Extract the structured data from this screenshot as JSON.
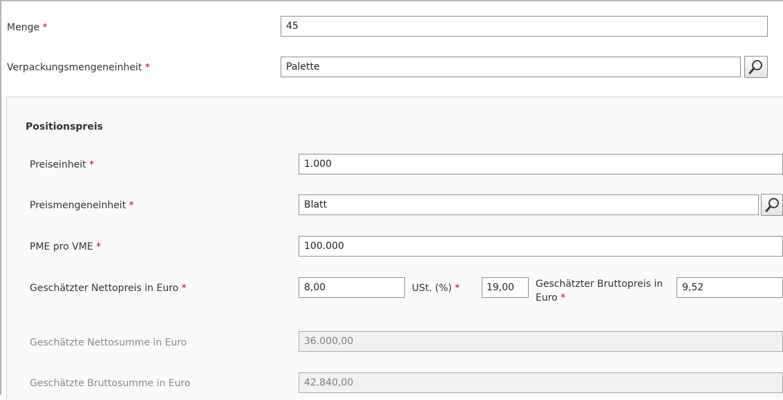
{
  "fields": {
    "menge": {
      "label": "Menge",
      "required": "*",
      "value": "45"
    },
    "verpackungsmengeneinheit": {
      "label": "Verpackungsmengeneinheit",
      "required": "*",
      "value": "Palette"
    }
  },
  "positionspreis": {
    "title": "Positionspreis",
    "preiseinheit": {
      "label": "Preiseinheit",
      "required": "*",
      "value": "1.000"
    },
    "preismengeneinheit": {
      "label": "Preismengeneinheit",
      "required": "*",
      "value": "Blatt"
    },
    "pme_pro_vme": {
      "label": "PME pro VME",
      "required": "*",
      "value": "100.000"
    },
    "nettopreis": {
      "label": "Geschätzter Nettopreis in Euro",
      "required": "*",
      "value": "8,00"
    },
    "ust": {
      "label": "USt. (%)",
      "required": "*",
      "value": "19,00"
    },
    "bruttopreis": {
      "label": "Geschätzter Bruttopreis in Euro",
      "required": "*",
      "value": "9,52"
    },
    "nettosumme": {
      "label": "Geschätzte Nettosumme in Euro",
      "value": "36.000,00"
    },
    "bruttosumme": {
      "label": "Geschätzte Bruttosumme in Euro",
      "value": "42.840,00"
    }
  },
  "icons": {
    "lookup": "magnifier-icon"
  },
  "colors": {
    "required": "#cc0000",
    "disabled_text": "#8a8a8a",
    "readonly_bg": "#f1f1f1"
  }
}
